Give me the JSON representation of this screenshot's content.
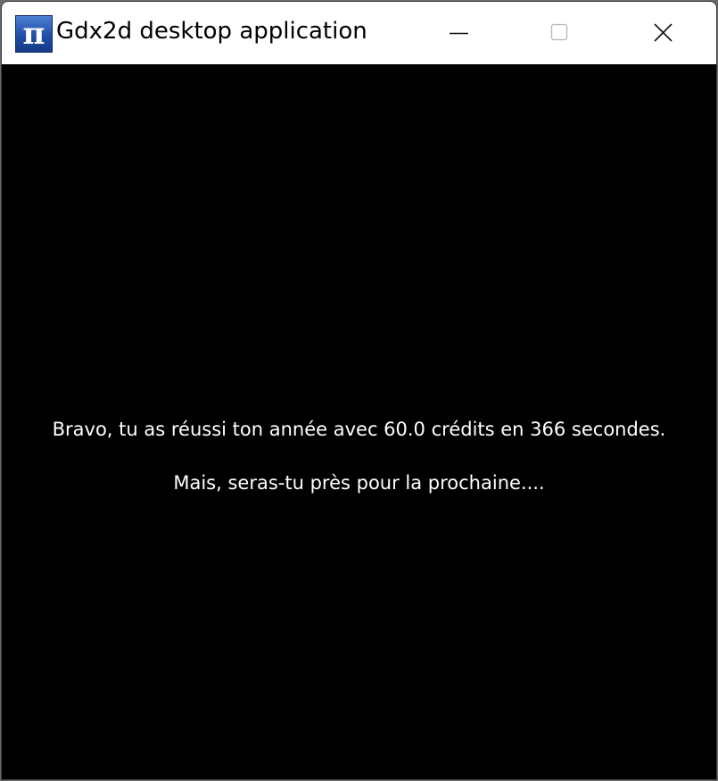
{
  "window": {
    "title": "Gdx2d desktop application",
    "icon": "pi-icon",
    "icon_glyph": "π",
    "controls": [
      "minimize-icon",
      "maximize-icon",
      "close-icon"
    ]
  },
  "game": {
    "message_line_1": "Bravo, tu as réussi ton année avec 60.0 crédits en 366 secondes.",
    "message_line_2": "Mais, seras-tu près pour la prochaine...."
  },
  "colors": {
    "background": "#000000",
    "text": "#ffffff",
    "titlebar": "#ffffff"
  }
}
